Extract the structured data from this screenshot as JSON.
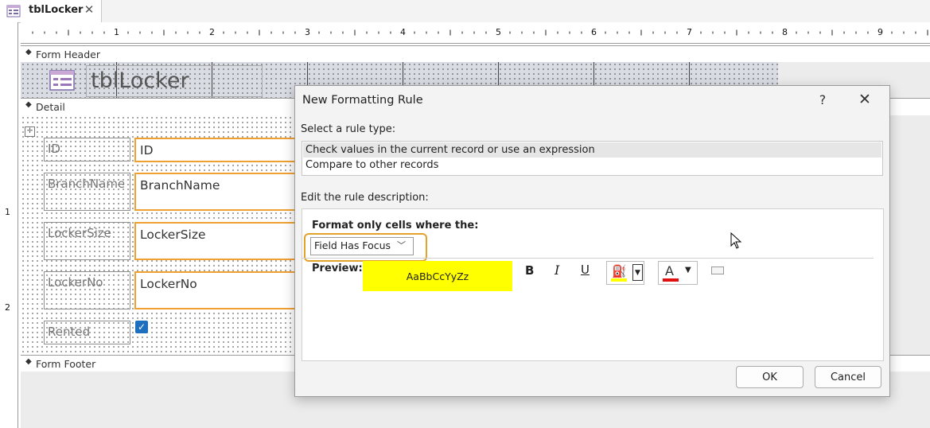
{
  "tab": {
    "title": "tblLocker",
    "close": "✕"
  },
  "ruler": {
    "h_numbers": [
      "1",
      "2",
      "3",
      "4",
      "5",
      "6",
      "7",
      "8",
      "9"
    ],
    "v_numbers": [
      "1",
      "2"
    ]
  },
  "sections": {
    "form_header": "Form Header",
    "detail": "Detail",
    "form_footer": "Form Footer"
  },
  "form_header": {
    "title": "tblLocker"
  },
  "detail": {
    "labels": [
      "ID",
      "BranchName",
      "LockerSize",
      "LockerNo",
      "Rented"
    ],
    "fields": [
      "ID",
      "BranchName",
      "LockerSize",
      "LockerNo"
    ],
    "rented_checked": true
  },
  "dialog": {
    "title": "New Formatting Rule",
    "help": "?",
    "close": "✕",
    "select_rule_label": "Select a rule type:",
    "rule_types": [
      "Check values in the current record or use an expression",
      "Compare to other records"
    ],
    "selected_rule_index": 0,
    "edit_rule_label": "Edit the rule description:",
    "format_only_label": "Format only cells where the:",
    "condition_value": "Field Has Focus",
    "preview_label": "Preview:",
    "preview_text": "AaBbCcYyZz",
    "preview_bg": "#ffff00",
    "bold": "B",
    "italic": "I",
    "underline": "U",
    "font_color_letter": "A",
    "fill_color": "#ffff00",
    "font_color": "#e01010",
    "ok_label": "OK",
    "cancel_label": "Cancel"
  }
}
